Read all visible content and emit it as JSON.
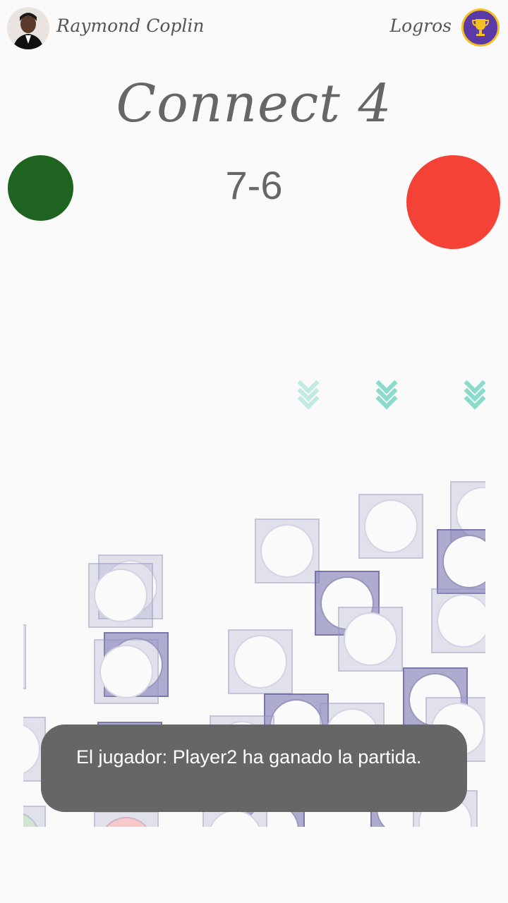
{
  "header": {
    "username": "Raymond Coplin",
    "achievements_label": "Logros",
    "avatar_icon": "user-photo",
    "trophy_icon": "trophy-icon"
  },
  "game": {
    "title": "Connect 4",
    "score": "7-6",
    "player1_color": "#1e6420",
    "player2_color": "#f44336"
  },
  "toast": {
    "message": "El jugador: Player2 ha ganado la partida."
  },
  "colors": {
    "background": "#fafafa",
    "chevron": "#7fd8c8",
    "trophy_bg": "#5b3aa8",
    "trophy_ring": "#f3c021"
  }
}
